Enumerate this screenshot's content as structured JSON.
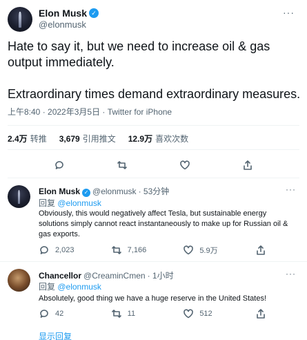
{
  "main_tweet": {
    "author_name": "Elon Musk",
    "author_handle": "@elonmusk",
    "more_glyph": "···",
    "paragraph1": "Hate to say it, but we need to increase oil & gas output immediately.",
    "paragraph2": "Extraordinary times demand extraordinary measures.",
    "timestamp": "上午8:40 · 2022年3月5日 · Twitter for iPhone",
    "stats": [
      {
        "value": "2.4万",
        "label": "转推"
      },
      {
        "value": "3,679",
        "label": "引用推文"
      },
      {
        "value": "12.9万",
        "label": "喜欢次数"
      }
    ],
    "actions": [
      "reply-icon",
      "retweet-icon",
      "like-icon",
      "share-icon"
    ]
  },
  "replies": [
    {
      "author_name": "Elon Musk",
      "author_handle": "@elonmusk",
      "time": "· 53分钟",
      "reply_prefix": "回复",
      "reply_to": "@elonmusk",
      "text": "Obviously, this would negatively affect Tesla, but sustainable energy solutions simply cannot react instantaneously to make up for Russian oil & gas exports.",
      "counts": {
        "reply": "2,023",
        "retweet": "7,166",
        "like": "5.9万"
      },
      "more_glyph": "···"
    },
    {
      "author_name": "Chancellor",
      "author_handle": "@CreaminCmen",
      "time": "· 1小时",
      "reply_prefix": "回复",
      "reply_to": "@elonmusk",
      "text": "Absolutely, good thing we have a huge reserve in the United States!",
      "counts": {
        "reply": "42",
        "retweet": "11",
        "like": "512"
      },
      "more_glyph": "···"
    }
  ],
  "show_replies_label": "显示回复",
  "colors": {
    "accent": "#1d9bf0",
    "text": "#0f1419",
    "secondary": "#536471",
    "divider": "#eff3f4"
  }
}
